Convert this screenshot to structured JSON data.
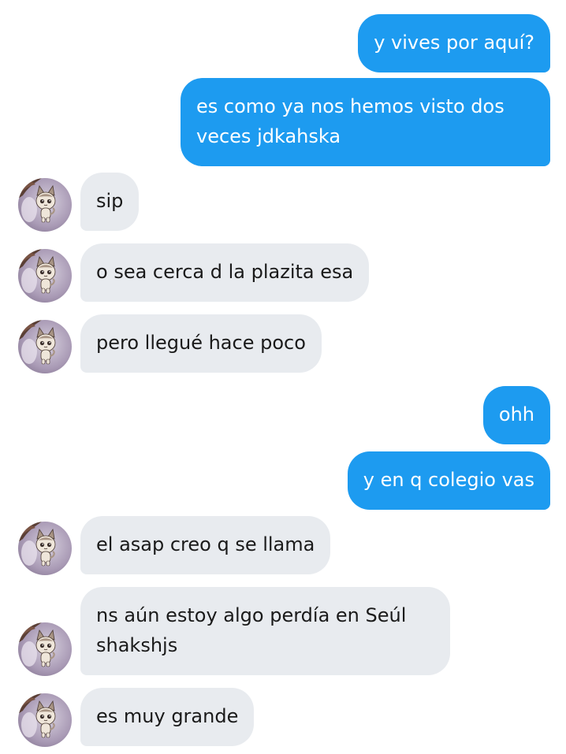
{
  "colors": {
    "outgoing_bubble": "#1d9bf0",
    "incoming_bubble": "#e8ebef",
    "outgoing_text": "#ffffff",
    "incoming_text": "#1a1a1a"
  },
  "contact": {
    "avatar_icon": "cat-avatar-icon"
  },
  "messages": [
    {
      "direction": "outgoing",
      "text": "y vives por aquí?"
    },
    {
      "direction": "outgoing",
      "text": "es como ya nos hemos visto dos veces jdkahska"
    },
    {
      "direction": "incoming",
      "text": "sip"
    },
    {
      "direction": "incoming",
      "text": "o sea cerca d la plazita esa"
    },
    {
      "direction": "incoming",
      "text": "pero llegué hace poco"
    },
    {
      "direction": "outgoing",
      "text": "ohh"
    },
    {
      "direction": "outgoing",
      "text": "y en q colegio vas"
    },
    {
      "direction": "incoming",
      "text": "el asap creo q se llama"
    },
    {
      "direction": "incoming",
      "text": "ns aún estoy algo perdía en Seúl shakshjs"
    },
    {
      "direction": "incoming",
      "text": "es muy grande"
    }
  ]
}
